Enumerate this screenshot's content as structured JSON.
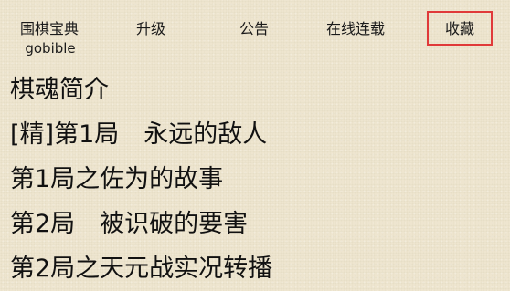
{
  "nav": {
    "brand_title": "围棋宝典",
    "brand_subtitle": "gobible",
    "upgrade": "升级",
    "notice": "公告",
    "serial": "在线连载",
    "favorites": "收藏"
  },
  "colors": {
    "background": "#eee5cf",
    "highlight_border": "#e03a3a",
    "text": "#111111"
  },
  "list": {
    "items": [
      "棋魂简介",
      "[精]第1局　永远的敌人",
      "第1局之佐为的故事",
      "第2局　被识破的要害",
      "第2局之天元战实况转播"
    ]
  }
}
